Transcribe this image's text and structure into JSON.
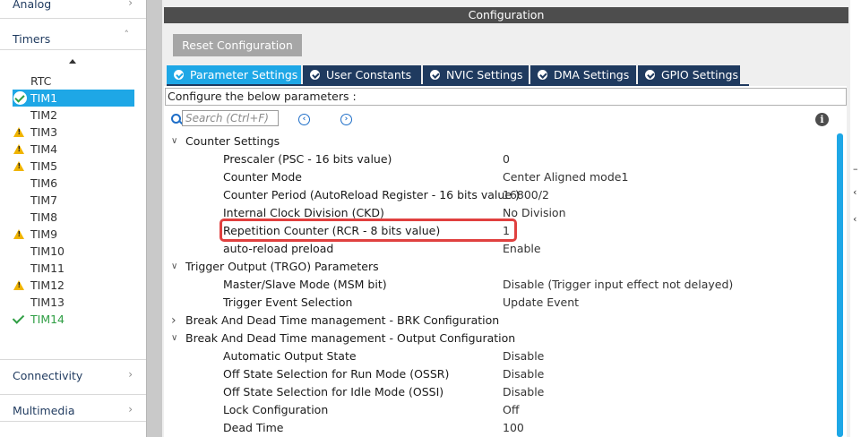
{
  "sidebar": {
    "categories": {
      "analog": "Analog",
      "timers": "Timers",
      "connectivity": "Connectivity",
      "multimedia": "Multimedia"
    },
    "peripherals": [
      {
        "label": "RTC",
        "status": "none"
      },
      {
        "label": "TIM1",
        "status": "ok-selected"
      },
      {
        "label": "TIM2",
        "status": "none"
      },
      {
        "label": "TIM3",
        "status": "warning"
      },
      {
        "label": "TIM4",
        "status": "warning"
      },
      {
        "label": "TIM5",
        "status": "warning"
      },
      {
        "label": "TIM6",
        "status": "none"
      },
      {
        "label": "TIM7",
        "status": "none"
      },
      {
        "label": "TIM8",
        "status": "none"
      },
      {
        "label": "TIM9",
        "status": "warning"
      },
      {
        "label": "TIM10",
        "status": "none"
      },
      {
        "label": "TIM11",
        "status": "none"
      },
      {
        "label": "TIM12",
        "status": "warning"
      },
      {
        "label": "TIM13",
        "status": "none"
      },
      {
        "label": "TIM14",
        "status": "ok"
      }
    ]
  },
  "config": {
    "title": "Configuration",
    "reset_label": "Reset Configuration",
    "tabs": [
      {
        "label": "Parameter Settings",
        "active": true
      },
      {
        "label": "User Constants",
        "active": false
      },
      {
        "label": "NVIC Settings",
        "active": false
      },
      {
        "label": "DMA Settings",
        "active": false
      },
      {
        "label": "GPIO Settings",
        "active": false
      }
    ],
    "describe": "Configure the below parameters :",
    "search_placeholder": "Search (Ctrl+F)",
    "sections": [
      {
        "title": "Counter Settings",
        "expanded": true,
        "params": [
          {
            "name": "Prescaler (PSC - 16 bits value)",
            "value": "0"
          },
          {
            "name": "Counter Mode",
            "value": "Center Aligned mode1"
          },
          {
            "name": "Counter Period (AutoReload Register - 16 bits value )",
            "value": "16800/2"
          },
          {
            "name": "Internal Clock Division (CKD)",
            "value": "No Division"
          },
          {
            "name": "Repetition Counter (RCR - 8 bits value)",
            "value": "1"
          },
          {
            "name": "auto-reload preload",
            "value": "Enable"
          }
        ]
      },
      {
        "title": "Trigger Output (TRGO) Parameters",
        "expanded": true,
        "params": [
          {
            "name": "Master/Slave Mode (MSM bit)",
            "value": "Disable (Trigger input effect not delayed)"
          },
          {
            "name": "Trigger Event Selection",
            "value": "Update Event"
          }
        ]
      },
      {
        "title": "Break And Dead Time management - BRK Configuration",
        "expanded": false,
        "params": []
      },
      {
        "title": "Break And Dead Time management - Output Configuration",
        "expanded": true,
        "params": [
          {
            "name": "Automatic Output State",
            "value": "Disable"
          },
          {
            "name": "Off State Selection for Run Mode (OSSR)",
            "value": "Disable"
          },
          {
            "name": "Off State Selection for Idle Mode (OSSI)",
            "value": "Disable"
          },
          {
            "name": "Lock Configuration",
            "value": "Off"
          },
          {
            "name": "Dead Time",
            "value": "100"
          }
        ]
      }
    ]
  },
  "colors": {
    "accent": "#1ea7e6",
    "tab_dark": "#1f3a5f",
    "highlight": "#e0403f",
    "warning": "#f0b400",
    "ok": "#2f9e44"
  }
}
